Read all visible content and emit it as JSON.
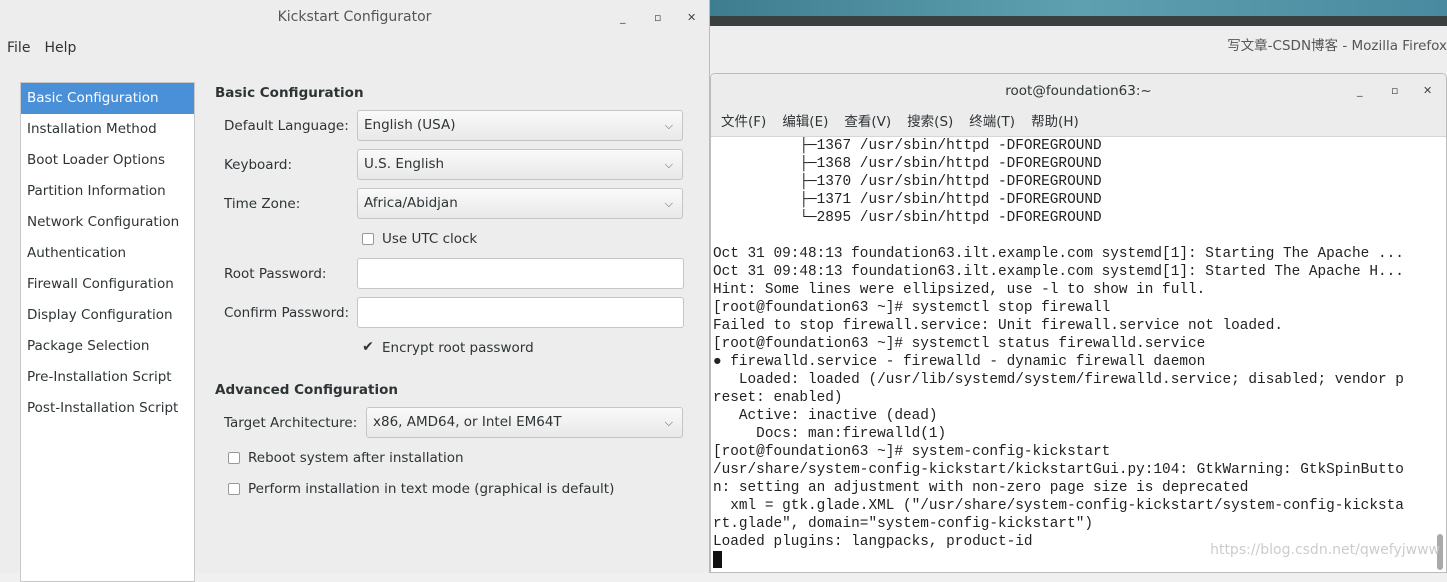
{
  "desktop": {
    "firefox_title": "写文章-CSDN博客 - Mozilla Firefox"
  },
  "kickstart": {
    "title": "Kickstart Configurator",
    "menu": [
      "File",
      "Help"
    ],
    "sidebar": [
      "Basic Configuration",
      "Installation Method",
      "Boot Loader Options",
      "Partition Information",
      "Network Configuration",
      "Authentication",
      "Firewall Configuration",
      "Display Configuration",
      "Package Selection",
      "Pre-Installation Script",
      "Post-Installation Script"
    ],
    "selected": "Basic Configuration",
    "basic": {
      "heading": "Basic Configuration",
      "language_label": "Default Language:",
      "language": "English (USA)",
      "keyboard_label": "Keyboard:",
      "keyboard": "U.S. English",
      "timezone_label": "Time Zone:",
      "timezone": "Africa/Abidjan",
      "utc_label": "Use UTC clock",
      "utc_checked": false,
      "root_pw_label": "Root Password:",
      "root_pw": "",
      "confirm_pw_label": "Confirm Password:",
      "confirm_pw": "",
      "encrypt_label": "Encrypt root password",
      "encrypt_checked": true
    },
    "advanced": {
      "heading": "Advanced Configuration",
      "arch_label": "Target Architecture:",
      "arch": "x86, AMD64, or Intel EM64T",
      "reboot_label": "Reboot system after installation",
      "reboot_checked": false,
      "text_mode_label": "Perform installation in text mode (graphical is default)",
      "text_mode_checked": false
    }
  },
  "terminal": {
    "title": "root@foundation63:~",
    "menu": [
      "文件(F)",
      "编辑(E)",
      "查看(V)",
      "搜索(S)",
      "终端(T)",
      "帮助(H)"
    ],
    "lines": [
      "          ├─1367 /usr/sbin/httpd -DFOREGROUND",
      "          ├─1368 /usr/sbin/httpd -DFOREGROUND",
      "          ├─1370 /usr/sbin/httpd -DFOREGROUND",
      "          ├─1371 /usr/sbin/httpd -DFOREGROUND",
      "          └─2895 /usr/sbin/httpd -DFOREGROUND",
      "",
      "Oct 31 09:48:13 foundation63.ilt.example.com systemd[1]: Starting The Apache ...",
      "Oct 31 09:48:13 foundation63.ilt.example.com systemd[1]: Started The Apache H...",
      "Hint: Some lines were ellipsized, use -l to show in full.",
      "[root@foundation63 ~]# systemctl stop firewall",
      "Failed to stop firewall.service: Unit firewall.service not loaded.",
      "[root@foundation63 ~]# systemctl status firewalld.service",
      "● firewalld.service - firewalld - dynamic firewall daemon",
      "   Loaded: loaded (/usr/lib/systemd/system/firewalld.service; disabled; vendor p",
      "reset: enabled)",
      "   Active: inactive (dead)",
      "     Docs: man:firewalld(1)",
      "[root@foundation63 ~]# system-config-kickstart",
      "/usr/share/system-config-kickstart/kickstartGui.py:104: GtkWarning: GtkSpinButto",
      "n: setting an adjustment with non-zero page size is deprecated",
      "  xml = gtk.glade.XML (\"/usr/share/system-config-kickstart/system-config-kicksta",
      "rt.glade\", domain=\"system-config-kickstart\")",
      "Loaded plugins: langpacks, product-id"
    ]
  },
  "watermark": "https://blog.csdn.net/qwefyjwww"
}
